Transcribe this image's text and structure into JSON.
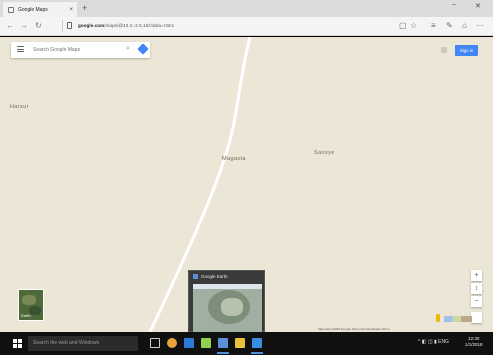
{
  "browser": {
    "tab_title": "Google Maps",
    "tab_close_glyph": "×",
    "new_tab_glyph": "+",
    "minimize_glyph": "−",
    "close_glyph": "✕",
    "back_glyph": "←",
    "forward_glyph": "→",
    "refresh_glyph": "↻",
    "url_domain": "google.com",
    "url_path": "/maps/@43.2,-2.5,16z/data=!3m1",
    "reading_glyph": "▢",
    "favorite_glyph": "☆",
    "hub_glyph": "≡",
    "notes_glyph": "✎",
    "share_glyph": "⌂",
    "more_glyph": "···"
  },
  "map": {
    "search_placeholder": "Search Google Maps",
    "search_glyph": "⌕",
    "signin_label": "Sign in",
    "labels": {
      "left": "Harsur",
      "center": "Magasta",
      "right": "Sansye"
    },
    "satellite_label": "Earth",
    "zoom_in": "+",
    "zoom_out": "−",
    "rotate": "↕",
    "footer_text": "Map data ©2018 Google   Terms   Send feedback   100 m"
  },
  "popup": {
    "title": "Google Earth"
  },
  "taskbar": {
    "search_placeholder": "Search the web and Windows",
    "tray_icons": "^ ◧ ◫ ▮ ENG",
    "time": "12:30",
    "date": "1/1/2018"
  },
  "colors": {
    "map_bg": "#ece6d6",
    "road": "#ffffff",
    "accent": "#4285f4",
    "taskbar": "#101010"
  }
}
